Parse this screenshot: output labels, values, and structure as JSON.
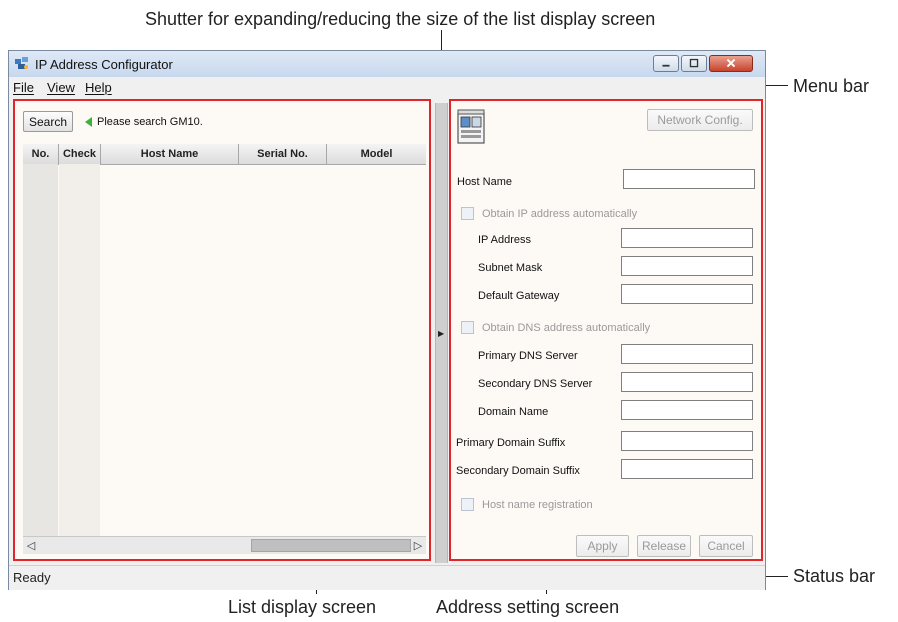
{
  "callouts": {
    "shutter": "Shutter for expanding/reducing the size of the list display screen",
    "menu_bar": "Menu bar",
    "status_bar": "Status bar",
    "list_display": "List display screen",
    "address_setting": "Address setting screen"
  },
  "window": {
    "title": "IP Address Configurator",
    "icon": "network-config-icon"
  },
  "menu": {
    "file": "File",
    "view": "View",
    "help": "Help"
  },
  "list_panel": {
    "search_label": "Search",
    "hint": "Please search GM10.",
    "columns": [
      "No.",
      "Check",
      "Host Name",
      "Serial No.",
      "Model"
    ]
  },
  "settings_panel": {
    "network_config_label": "Network Config.",
    "host_name_label": "Host Name",
    "obtain_ip_label": "Obtain IP address automatically",
    "ip_address_label": "IP Address",
    "subnet_mask_label": "Subnet Mask",
    "default_gateway_label": "Default Gateway",
    "obtain_dns_label": "Obtain DNS address automatically",
    "primary_dns_label": "Primary DNS Server",
    "secondary_dns_label": "Secondary DNS Server",
    "domain_name_label": "Domain Name",
    "primary_suffix_label": "Primary Domain Suffix",
    "secondary_suffix_label": "Secondary Domain Suffix",
    "host_registration_label": "Host name registration",
    "apply_label": "Apply",
    "release_label": "Release",
    "cancel_label": "Cancel"
  },
  "status": {
    "text": "Ready"
  },
  "colors": {
    "highlight": "#e0262a",
    "panel_bg": "#fdfaf5",
    "hint_arrow": "#3cb23c"
  }
}
